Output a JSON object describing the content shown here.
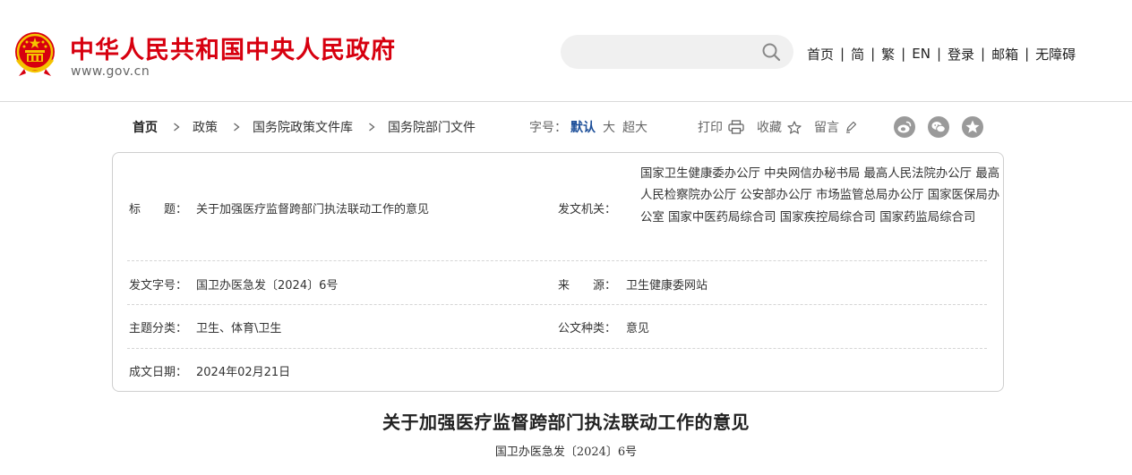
{
  "header": {
    "site_title": "中华人民共和国中央人民政府",
    "site_domain": "www.gov.cn",
    "search": {
      "value": "",
      "placeholder": ""
    },
    "nav": [
      "首页",
      "简",
      "繁",
      "EN",
      "登录",
      "邮箱",
      "无障碍"
    ],
    "nav_separator": "|"
  },
  "breadcrumb": [
    "首页",
    "政策",
    "国务院政策文件库",
    "国务院部门文件"
  ],
  "tools": {
    "font_size_label": "字号：",
    "font_sizes": [
      "默认",
      "大",
      "超大"
    ],
    "active_font_size": "默认",
    "print": "打印",
    "favorite": "收藏",
    "comment": "留言",
    "share_icons": [
      "weibo-icon",
      "wechat-icon",
      "qzone-icon"
    ]
  },
  "info": {
    "title_label": "标　　题：",
    "title_value": "关于加强医疗监督跨部门执法联动工作的意见",
    "issuer_label": "发文机关：",
    "issuer_value": "国家卫生健康委办公厅 中央网信办秘书局 最高人民法院办公厅 最高人民检察院办公厅 公安部办公厅 市场监管总局办公厅 国家医保局办公室 国家中医药局综合司 国家疾控局综合司 国家药监局综合司",
    "doc_no_label": "发文字号：",
    "doc_no_value": "国卫办医急发〔2024〕6号",
    "source_label": "来　　源：",
    "source_value": "卫生健康委网站",
    "topic_label": "主题分类：",
    "topic_value": "卫生、体育\\卫生",
    "type_label": "公文种类：",
    "type_value": "意见",
    "date_label": "成文日期：",
    "date_value": "2024年02月21日"
  },
  "document": {
    "title": "关于加强医疗监督跨部门执法联动工作的意见",
    "number": "国卫办医急发〔2024〕6号"
  },
  "colors": {
    "brand_red": "#d7000f",
    "active_blue": "#1d4f99",
    "icon_gray": "#9a9a9a",
    "border": "#cfcfcf"
  }
}
